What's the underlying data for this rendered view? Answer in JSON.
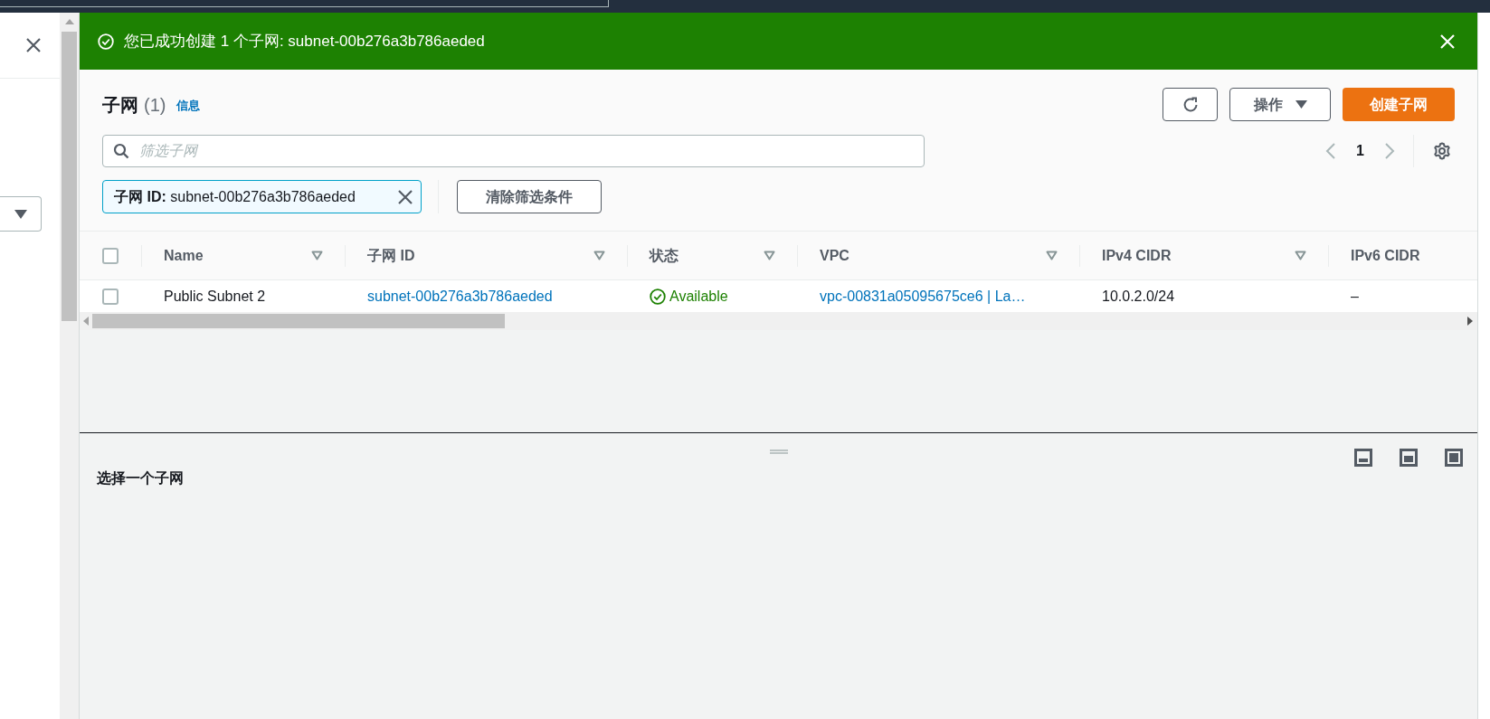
{
  "banner": {
    "message": "您已成功创建 1 个子网: subnet-00b276a3b786aeded"
  },
  "header": {
    "title": "子网",
    "count": "(1)",
    "info_link": "信息",
    "actions_button": "操作",
    "create_button": "创建子网"
  },
  "search": {
    "placeholder": "筛选子网"
  },
  "pagination": {
    "page": "1"
  },
  "filter_token": {
    "label": "子网 ID:",
    "value": "subnet-00b276a3b786aeded"
  },
  "clear_filters_button": "清除筛选条件",
  "table": {
    "select_all": {
      "checked": false
    },
    "columns": [
      {
        "label": "Name",
        "filterable": true
      },
      {
        "label": "子网 ID",
        "filterable": true
      },
      {
        "label": "状态",
        "filterable": true
      },
      {
        "label": "VPC",
        "filterable": true
      },
      {
        "label": "IPv4 CIDR",
        "filterable": true
      },
      {
        "label": "IPv6 CIDR",
        "filterable": false
      }
    ],
    "rows": [
      {
        "selected": false,
        "cells": [
          {
            "kind": "text",
            "text": "Public Subnet 2"
          },
          {
            "kind": "link",
            "text": "subnet-00b276a3b786aeded"
          },
          {
            "kind": "status",
            "text": "Available"
          },
          {
            "kind": "link",
            "text": "vpc-00831a05095675ce6 | La…"
          },
          {
            "kind": "text",
            "text": "10.0.2.0/24"
          },
          {
            "kind": "text",
            "text": "–"
          }
        ]
      }
    ]
  },
  "details_panel": {
    "message": "选择一个子网"
  }
}
